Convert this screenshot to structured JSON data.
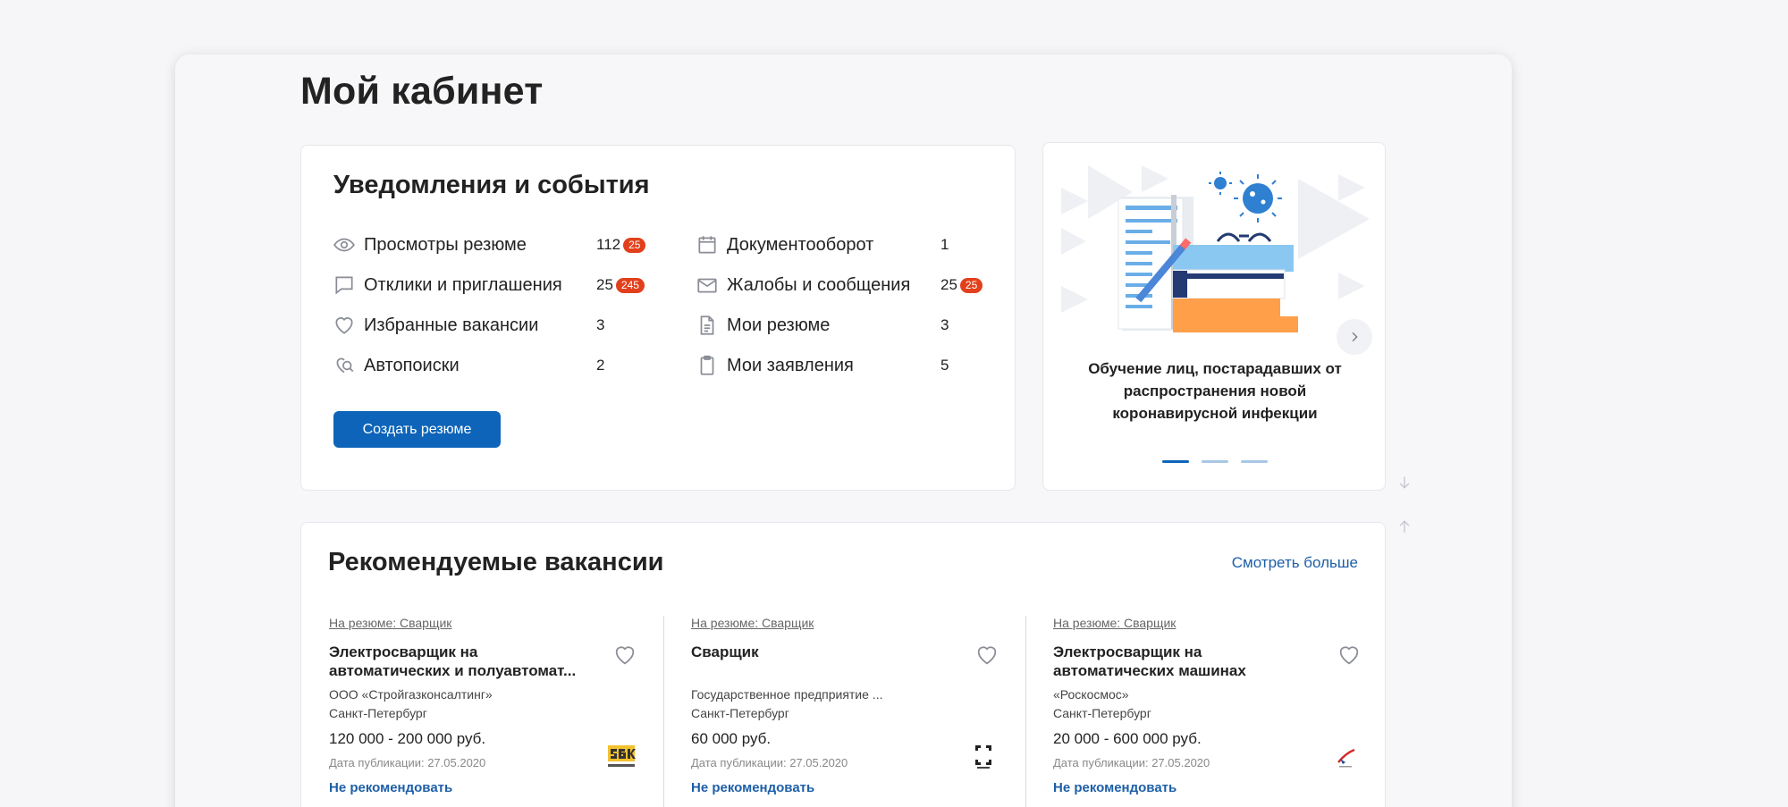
{
  "page": {
    "title": "Мой кабинет"
  },
  "notifications": {
    "title": "Уведомления и события",
    "left_items": [
      {
        "label": "Просмотры резюме",
        "count": "112",
        "badge": "25",
        "icon": "eye-icon"
      },
      {
        "label": "Отклики и приглашения",
        "count": "25",
        "badge": "245",
        "icon": "chat-icon"
      },
      {
        "label": "Избранные вакансии",
        "count": "3",
        "icon": "heart-icon"
      },
      {
        "label": "Автопоиски",
        "count": "2",
        "icon": "autosearch-icon"
      }
    ],
    "right_items": [
      {
        "label": "Документооборот",
        "count": "1",
        "icon": "calendar-icon"
      },
      {
        "label": "Жалобы и сообщения",
        "count": "25",
        "badge": "25",
        "icon": "mail-icon"
      },
      {
        "label": "Мои резюме",
        "count": "3",
        "icon": "document-icon"
      },
      {
        "label": "Мои заявления",
        "count": "5",
        "icon": "clipboard-icon"
      }
    ],
    "create_button": "Создать резюме",
    "colors": {
      "accent": "#0d64b8",
      "badge": "#e2401c"
    }
  },
  "promo": {
    "caption": "Обучение лиц, постарадавших от распространения новой коронавирусной инфекции",
    "active_slide": 1,
    "slide_count": 3
  },
  "vacancies": {
    "title": "Рекомендуемые вакансии",
    "more_link": "Смотреть больше",
    "items": [
      {
        "resume": "На резюме: Сварщик",
        "title": "Электросварщик на автоматических и полуавтомат...",
        "company": "ООО «Стройгазконсалтинг»",
        "city": "Санкт-Петербург",
        "salary": "120 000 - 200 000 руб.",
        "date": "Дата публикации: 27.05.2020",
        "not_recommend": "Не рекомендовать",
        "logo": "sgk-logo"
      },
      {
        "resume": "На резюме: Сварщик",
        "title": "Сварщик",
        "company": "Государственное предприятие ...",
        "city": "Санкт-Петербург",
        "salary": "60 000 руб.",
        "date": "Дата публикации: 27.05.2020",
        "not_recommend": "Не рекомендовать",
        "logo": "rostec-logo"
      },
      {
        "resume": "На резюме: Сварщик",
        "title": "Электросварщик на автоматических машинах",
        "company": "«Роскосмос»",
        "city": "Санкт-Петербург",
        "salary": "20 000 - 600 000 руб.",
        "date": "Дата публикации: 27.05.2020",
        "not_recommend": "Не рекомендовать",
        "logo": "roscosmos-logo"
      }
    ]
  }
}
